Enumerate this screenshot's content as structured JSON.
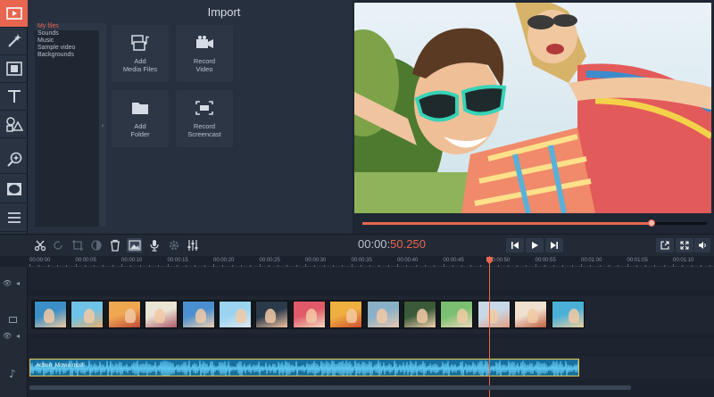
{
  "import": {
    "title": "Import",
    "file_list": [
      "My files",
      "Sounds",
      "Music",
      "Sample video",
      "Backgrounds"
    ],
    "tiles": [
      {
        "label": "Add\nMedia Files",
        "icon": "media-files-icon"
      },
      {
        "label": "Record\nVideo",
        "icon": "camera-icon"
      },
      {
        "label": "Add\nFolder",
        "icon": "folder-icon"
      },
      {
        "label": "Record\nScreencast",
        "icon": "screencast-icon"
      }
    ]
  },
  "rail": {
    "items": [
      "import-icon",
      "magic-wand-icon",
      "filmstrip-icon",
      "text-icon",
      "shapes-icon",
      "zoom-icon",
      "vignette-icon",
      "list-icon"
    ]
  },
  "player": {
    "timecode_prefix": "00:00:",
    "timecode_suffix": "50.250",
    "progress": 0.84
  },
  "timeline": {
    "ruler": [
      "00:00:00",
      "00:00:05",
      "00:00:10",
      "00:00:15",
      "00:00:20",
      "00:00:25",
      "00:00:30",
      "00:00:35",
      "00:00:40",
      "00:00:45",
      "00:00:50",
      "00:00:55",
      "00:01:00",
      "00:01:05",
      "00:01:10"
    ],
    "audio_label": "Action_Movie.mp3",
    "clip_count": 15
  },
  "colors": {
    "accent": "#e8664f",
    "panel": "#27303e",
    "audio": "#1a6f9c"
  }
}
